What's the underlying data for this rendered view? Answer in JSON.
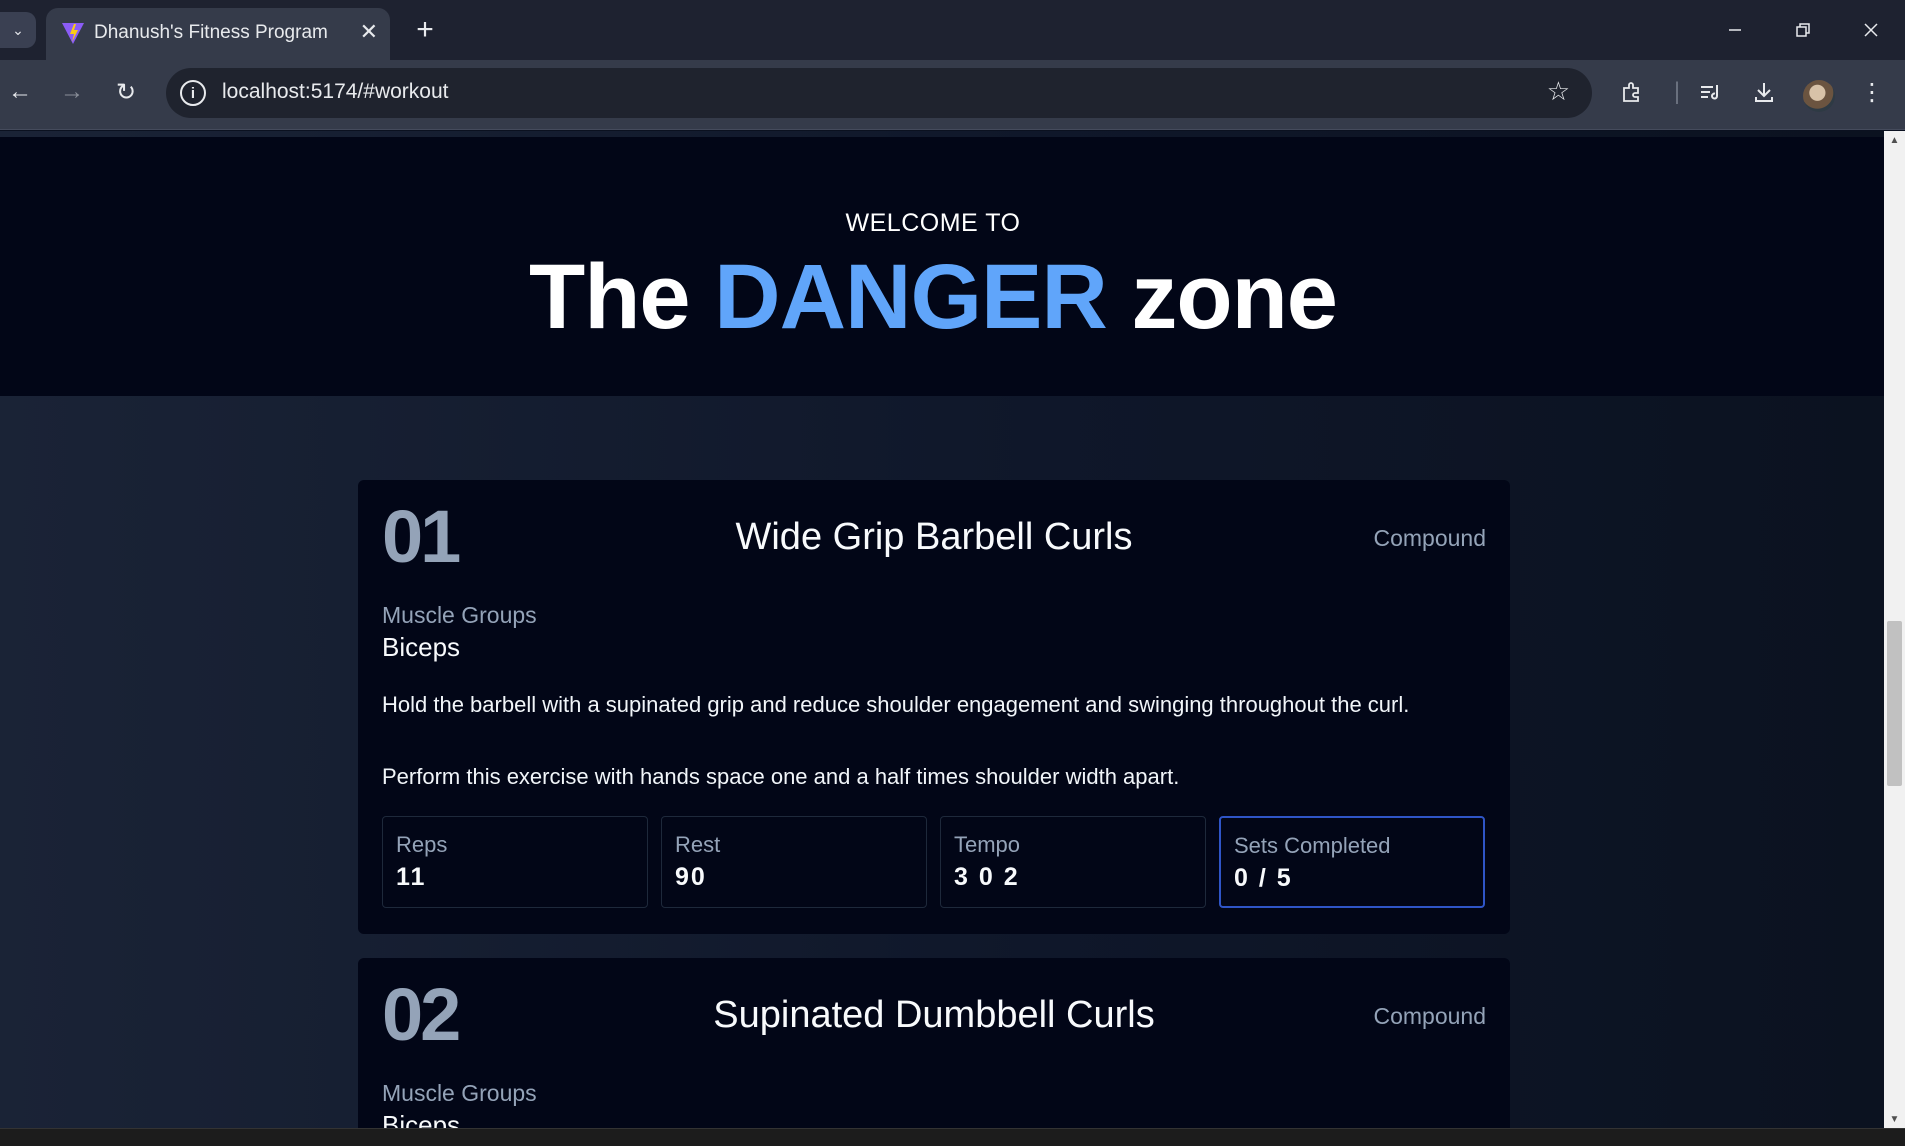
{
  "browser": {
    "tab_title": "Dhanush's Fitness Program",
    "url": "localhost:5174/#workout",
    "new_tab_symbol": "+",
    "close_tab_symbol": "✕"
  },
  "hero": {
    "welcome": "WELCOME TO",
    "title_pre": "The ",
    "title_accent": "DANGER",
    "title_post": " zone"
  },
  "exercises": [
    {
      "number": "01",
      "name": "Wide Grip Barbell Curls",
      "type": "Compound",
      "muscle_groups_label": "Muscle Groups",
      "muscle_groups": "Biceps",
      "description_1": "Hold the barbell with a supinated grip and reduce shoulder engagement and swinging throughout the curl.",
      "description_2": "Perform this exercise with hands space one and a half times shoulder width apart.",
      "stats": [
        {
          "label": "Reps",
          "value": "11"
        },
        {
          "label": "Rest",
          "value": "90"
        },
        {
          "label": "Tempo",
          "value": "3 0 2"
        },
        {
          "label": "Sets Completed",
          "value": "0 / 5"
        }
      ]
    },
    {
      "number": "02",
      "name": "Supinated Dumbbell Curls",
      "type": "Compound",
      "muscle_groups_label": "Muscle Groups",
      "muscle_groups": "Biceps"
    }
  ],
  "colors": {
    "accent": "#60a5fa",
    "hero_bg": "#020617",
    "card_bg": "#020617",
    "active_border": "#2f55c7"
  }
}
